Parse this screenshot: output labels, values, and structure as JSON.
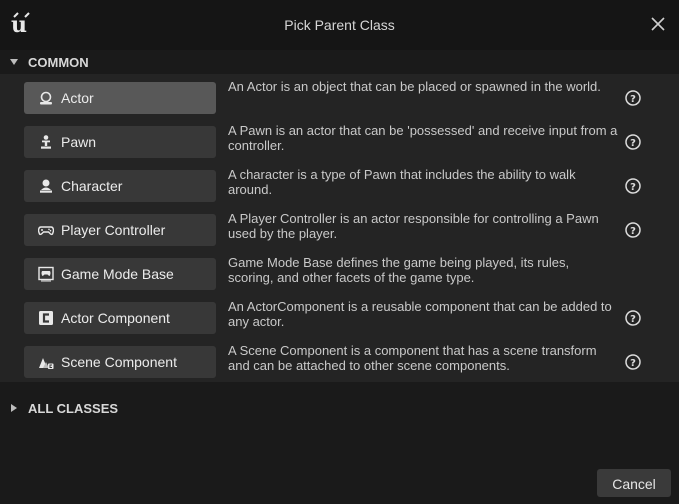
{
  "window": {
    "title": "Pick Parent Class"
  },
  "sections": {
    "common": {
      "label": "COMMON"
    },
    "all_classes": {
      "label": "ALL CLASSES"
    }
  },
  "classes": [
    {
      "label": "Actor",
      "icon": "actor-icon",
      "description": "An Actor is an object that can be placed or spawned in the world.",
      "selected": true,
      "has_help": true
    },
    {
      "label": "Pawn",
      "icon": "pawn-icon",
      "description": "A Pawn is an actor that can be 'possessed' and receive input from a controller.",
      "has_help": true
    },
    {
      "label": "Character",
      "icon": "character-icon",
      "description": "A character is a type of Pawn that includes the ability to walk around.",
      "has_help": true
    },
    {
      "label": "Player Controller",
      "icon": "gamepad-icon",
      "description": "A Player Controller is an actor responsible for controlling a Pawn used by the player.",
      "has_help": true
    },
    {
      "label": "Game Mode Base",
      "icon": "game-mode-icon",
      "description": "Game Mode Base defines the game being played, its rules, scoring, and other facets of the game type.",
      "has_help": false
    },
    {
      "label": "Actor Component",
      "icon": "actor-component-icon",
      "description": "An ActorComponent is a reusable component that can be added to any actor.",
      "has_help": true
    },
    {
      "label": "Scene Component",
      "icon": "scene-component-icon",
      "description": "A Scene Component is a component that has a scene transform and can be attached to other scene components.",
      "has_help": true
    }
  ],
  "footer": {
    "cancel_label": "Cancel"
  },
  "colors": {
    "window_bg": "#1a1a1a",
    "titlebar_bg": "#151515",
    "section_bg": "#242424",
    "button_bg": "#383838",
    "button_selected_bg": "#585858"
  }
}
